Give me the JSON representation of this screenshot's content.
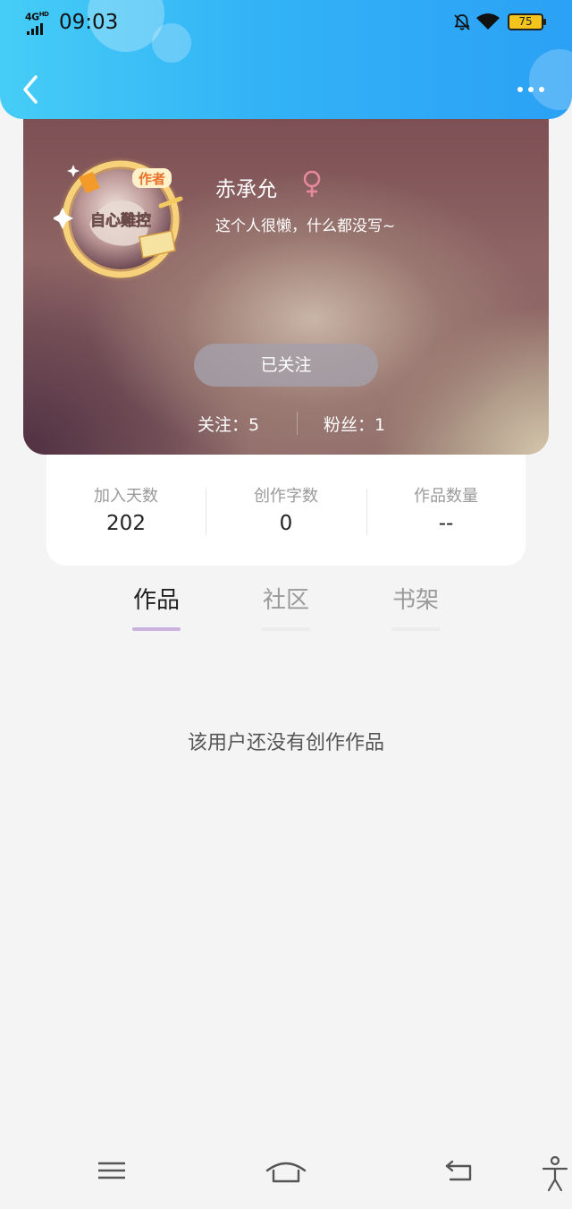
{
  "status_bar": {
    "network": "4G",
    "network_sup": "HD",
    "time": "09:03",
    "battery": "75"
  },
  "profile": {
    "avatar_badge": "作者",
    "avatar_text": "自心難控",
    "nickname": "赤承允",
    "bio": "这个人很懒，什么都没写~",
    "follow_button": "已关注",
    "following_label": "关注：5",
    "fans_label": "粉丝：1"
  },
  "counts": [
    {
      "label": "加入天数",
      "value": "202"
    },
    {
      "label": "创作字数",
      "value": "0"
    },
    {
      "label": "作品数量",
      "value": "--"
    }
  ],
  "tabs": [
    {
      "label": "作品",
      "active": true
    },
    {
      "label": "社区",
      "active": false
    },
    {
      "label": "书架",
      "active": false
    }
  ],
  "empty_message": "该用户还没有创作作品",
  "colors": {
    "header_start": "#46cdf6",
    "header_end": "#2ba1f5",
    "active_tab_underline": "#c9b2dd",
    "gender_female": "#e6899f",
    "battery": "#f3c41b"
  },
  "icons": {
    "back": "chevron-left-icon",
    "more": "more-dots-icon",
    "gender": "female-icon",
    "nav_menu": "menu-icon",
    "nav_home": "home-icon",
    "nav_back": "back-icon",
    "nav_accessibility": "accessibility-icon"
  }
}
